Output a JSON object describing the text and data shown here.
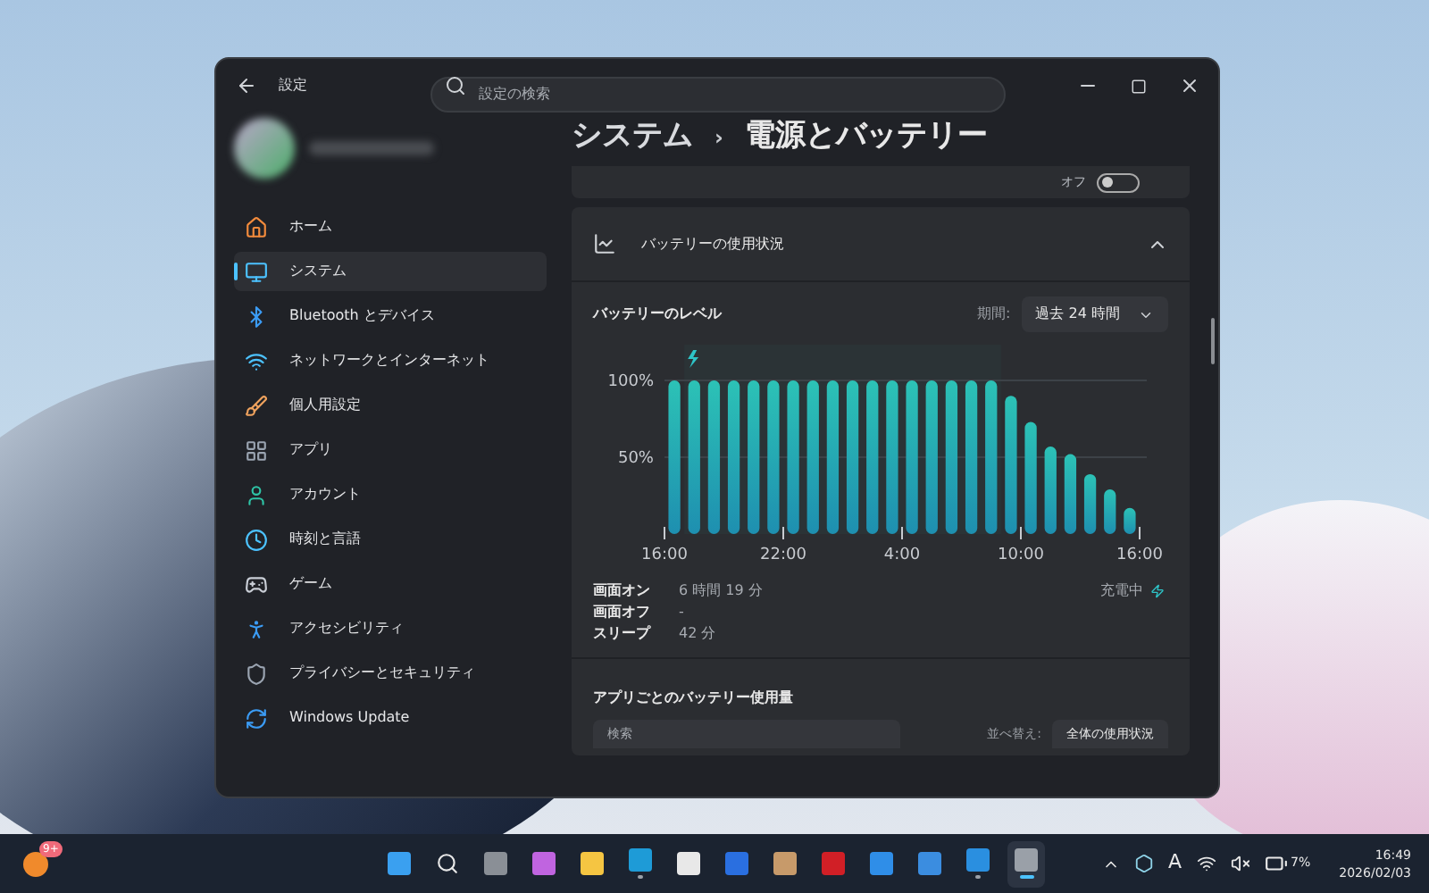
{
  "window": {
    "title": "設定",
    "search": {
      "placeholder": "設定の検索"
    }
  },
  "sidebar": {
    "items": [
      {
        "label": "ホーム",
        "selected": false
      },
      {
        "label": "システム",
        "selected": true
      },
      {
        "label": "Bluetooth とデバイス",
        "selected": false
      },
      {
        "label": "ネットワークとインターネット",
        "selected": false
      },
      {
        "label": "個人用設定",
        "selected": false
      },
      {
        "label": "アプリ",
        "selected": false
      },
      {
        "label": "アカウント",
        "selected": false
      },
      {
        "label": "時刻と言語",
        "selected": false
      },
      {
        "label": "ゲーム",
        "selected": false
      },
      {
        "label": "アクセシビリティ",
        "selected": false
      },
      {
        "label": "プライバシーとセキュリティ",
        "selected": false
      },
      {
        "label": "Windows Update",
        "selected": false
      }
    ]
  },
  "breadcrumb": {
    "parent": "システム",
    "separator": "›",
    "current": "電源とバッテリー"
  },
  "brightness_setting": {
    "state": "オフ",
    "on": false
  },
  "usage": {
    "title": "バッテリーの使用状況",
    "expanded": true,
    "level_title": "バッテリーのレベル",
    "period_label": "期間:",
    "period": "過去 24 時間",
    "chart_data": {
      "type": "bar",
      "categories": [
        "16:00",
        null,
        null,
        null,
        null,
        null,
        "22:00",
        null,
        null,
        null,
        null,
        null,
        "4:00",
        null,
        null,
        null,
        null,
        null,
        "10:00",
        null,
        null,
        null,
        null,
        null
      ],
      "values": [
        100,
        100,
        100,
        100,
        100,
        100,
        100,
        100,
        100,
        100,
        100,
        100,
        100,
        100,
        100,
        100,
        100,
        90,
        73,
        57,
        52,
        39,
        29,
        17
      ],
      "ylim": [
        0,
        100
      ],
      "yticks": [
        {
          "value": 50,
          "label": "50%"
        },
        {
          "value": 100,
          "label": "100%"
        }
      ]
    },
    "chart_end_label": "16:00",
    "stats": [
      {
        "label": "画面オン",
        "value": "6 時間 19 分"
      },
      {
        "label": "画面オフ",
        "value": "-"
      },
      {
        "label": "スリープ",
        "value": "42 分"
      }
    ],
    "status": "充電中"
  },
  "per_app": {
    "title": "アプリごとのバッテリー使用量",
    "search": {
      "placeholder": "検索"
    },
    "sort_label": "並べ替え:",
    "sort": "全体の使用状況"
  },
  "taskbar": {
    "widget_badge": "9+",
    "apps": [
      {
        "running": false,
        "selected": false
      },
      {
        "running": false,
        "selected": false
      },
      {
        "running": false,
        "selected": false
      },
      {
        "running": false,
        "selected": false
      },
      {
        "running": false,
        "selected": false
      },
      {
        "running": true,
        "selected": false
      },
      {
        "running": false,
        "selected": false
      },
      {
        "running": false,
        "selected": false
      },
      {
        "running": false,
        "selected": false
      },
      {
        "running": false,
        "selected": false
      },
      {
        "running": false,
        "selected": false
      },
      {
        "running": false,
        "selected": false
      },
      {
        "running": true,
        "selected": false
      },
      {
        "running": true,
        "selected": true
      }
    ],
    "ime": "A",
    "battery": "7%",
    "time": "16:49",
    "date": "2026/02/03"
  }
}
